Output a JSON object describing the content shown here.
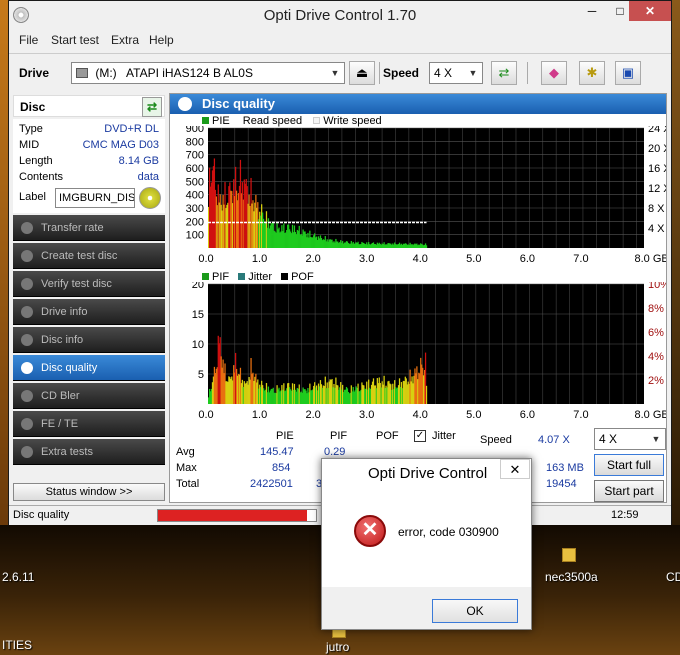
{
  "window": {
    "title": "Opti Drive Control 1.70",
    "minimize": "─",
    "maximize": "□",
    "close": "✕"
  },
  "menu": [
    "File",
    "Start test",
    "Extra",
    "Help"
  ],
  "toolbar": {
    "drive_label": "Drive",
    "drive_letter": "(M:)",
    "drive_value": "ATAPI iHAS124   B AL0S",
    "speed_label": "Speed",
    "speed_value": "4 X"
  },
  "disc": {
    "title": "Disc",
    "fields": [
      {
        "key": "Type",
        "value": "DVD+R DL"
      },
      {
        "key": "MID",
        "value": "CMC MAG D03"
      },
      {
        "key": "Length",
        "value": "8.14 GB"
      },
      {
        "key": "Contents",
        "value": "data"
      }
    ],
    "label_key": "Label",
    "label_value": "IMGBURN_DIS"
  },
  "nav": [
    {
      "label": "Transfer rate"
    },
    {
      "label": "Create test disc"
    },
    {
      "label": "Verify test disc"
    },
    {
      "label": "Drive info"
    },
    {
      "label": "Disc info"
    },
    {
      "label": "Disc quality"
    },
    {
      "label": "CD Bler"
    },
    {
      "label": "FE / TE"
    },
    {
      "label": "Extra tests"
    }
  ],
  "status_window_btn": "Status window >>",
  "panel_title": "Disc quality",
  "chart_data": [
    {
      "type": "bar",
      "series": [
        {
          "name": "PIE",
          "color": "#1a9a1a"
        },
        {
          "name": "Read speed",
          "color": "#ffffff"
        },
        {
          "name": "Write speed",
          "color": "#ffffff"
        }
      ],
      "x_ticks": [
        "0.0",
        "1.0",
        "2.0",
        "3.0",
        "4.0",
        "5.0",
        "6.0",
        "7.0",
        "8.0 GB"
      ],
      "y_ticks": [
        "900",
        "800",
        "700",
        "600",
        "500",
        "400",
        "300",
        "200",
        "100"
      ],
      "y2_ticks": [
        "24 X",
        "20 X",
        "16 X",
        "12 X",
        "8 X",
        "4 X"
      ],
      "xlim": [
        0,
        8.14
      ],
      "ylim": [
        0,
        900
      ],
      "profile": [
        [
          0.0,
          560
        ],
        [
          0.05,
          820
        ],
        [
          0.12,
          700
        ],
        [
          0.2,
          460
        ],
        [
          0.3,
          500
        ],
        [
          0.4,
          560
        ],
        [
          0.5,
          640
        ],
        [
          0.55,
          580
        ],
        [
          0.6,
          690
        ],
        [
          0.7,
          600
        ],
        [
          0.8,
          520
        ],
        [
          0.9,
          420
        ],
        [
          1.0,
          340
        ],
        [
          1.1,
          270
        ],
        [
          1.2,
          220
        ],
        [
          1.3,
          190
        ],
        [
          1.5,
          200
        ],
        [
          1.7,
          170
        ],
        [
          1.9,
          130
        ],
        [
          2.1,
          100
        ],
        [
          2.3,
          75
        ],
        [
          2.5,
          60
        ],
        [
          2.8,
          50
        ],
        [
          3.1,
          45
        ],
        [
          3.5,
          42
        ],
        [
          3.9,
          38
        ],
        [
          4.08,
          36
        ]
      ],
      "read_speed": 4.07,
      "tested_to": 4.08
    },
    {
      "type": "bar",
      "series": [
        {
          "name": "PIF",
          "color": "#1a9a1a"
        },
        {
          "name": "Jitter",
          "color": "#2a7a7a"
        },
        {
          "name": "POF",
          "color": "#000000"
        }
      ],
      "x_ticks": [
        "0.0",
        "1.0",
        "2.0",
        "3.0",
        "4.0",
        "5.0",
        "6.0",
        "7.0",
        "8.0 GB"
      ],
      "y_ticks": [
        "20",
        "15",
        "10",
        "5"
      ],
      "y2_ticks": [
        "10%",
        "8%",
        "6%",
        "4%",
        "2%"
      ],
      "xlim": [
        0,
        8.14
      ],
      "ylim": [
        0,
        20
      ],
      "profile": [
        [
          0.0,
          2
        ],
        [
          0.1,
          6
        ],
        [
          0.15,
          10
        ],
        [
          0.2,
          14
        ],
        [
          0.3,
          7
        ],
        [
          0.4,
          5
        ],
        [
          0.5,
          9
        ],
        [
          0.6,
          6
        ],
        [
          0.7,
          4
        ],
        [
          0.8,
          8
        ],
        [
          0.9,
          5
        ],
        [
          1.0,
          4
        ],
        [
          1.2,
          3
        ],
        [
          1.5,
          4
        ],
        [
          1.8,
          3
        ],
        [
          2.0,
          4
        ],
        [
          2.3,
          5
        ],
        [
          2.6,
          3
        ],
        [
          2.9,
          4
        ],
        [
          3.2,
          5
        ],
        [
          3.5,
          4
        ],
        [
          3.8,
          6
        ],
        [
          3.95,
          8
        ],
        [
          4.05,
          9
        ],
        [
          4.08,
          3
        ]
      ]
    }
  ],
  "stats": {
    "headers": [
      "PIE",
      "PIF",
      "POF",
      "Jitter"
    ],
    "jitter_checked": "✓",
    "rows": [
      {
        "label": "Avg",
        "pie": "145.47",
        "pif": "0.29"
      },
      {
        "label": "Max",
        "pie": "854",
        "pif": ""
      },
      {
        "label": "Total",
        "pie": "2422501",
        "pif": "38"
      }
    ],
    "speed_label": "Speed",
    "speed_value": "4.07 X",
    "speed_select": "4 X",
    "position_value": "163 MB",
    "elapsed_value": "19454",
    "start_full": "Start full",
    "start_part": "Start part"
  },
  "statusbar": {
    "text": "Disc quality",
    "progress": 0.94,
    "time": "12:59"
  },
  "dialog": {
    "title": "Opti Drive Control",
    "close": "✕",
    "message": "error, code 030900",
    "icon": "✕",
    "ok": "OK"
  },
  "desktop": {
    "labels": [
      "2.6.11",
      "nec3500a",
      "CD",
      "ITIES",
      "jutro"
    ]
  }
}
